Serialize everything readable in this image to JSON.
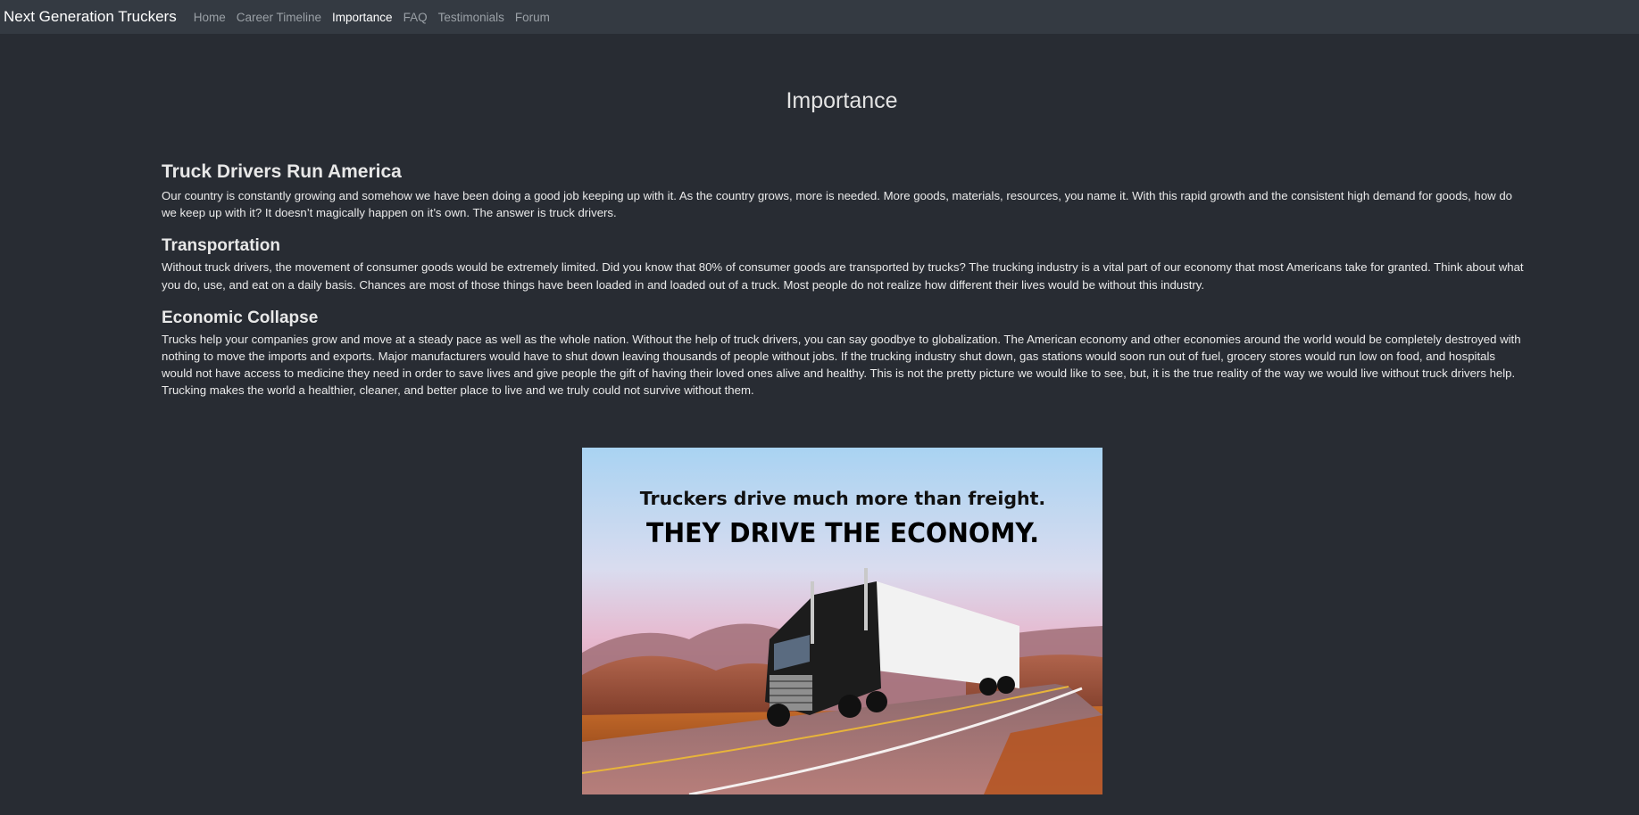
{
  "nav": {
    "brand": "Next Generation Truckers",
    "links": [
      "Home",
      "Career Timeline",
      "Importance",
      "FAQ",
      "Testimonials",
      "Forum"
    ],
    "active": "Importance"
  },
  "page": {
    "title": "Importance"
  },
  "sections": [
    {
      "heading": "Truck Drivers Run America",
      "text": "Our country is constantly growing and somehow we have been doing a good job keeping up with it. As the country grows, more is needed. More goods, materials, resources, you name it. With this rapid growth and the consistent high demand for goods, how do we keep up with it? It doesn’t magically happen on it’s own. The answer is truck drivers."
    },
    {
      "heading": "Transportation",
      "text": "Without truck drivers, the movement of consumer goods would be extremely limited. Did you know that 80% of consumer goods are transported by trucks? The trucking industry is a vital part of our economy that most Americans take for granted. Think about what you do, use, and eat on a daily basis. Chances are most of those things have been loaded in and loaded out of a truck. Most people do not realize how different their lives would be without this industry."
    },
    {
      "heading": "Economic Collapse",
      "text": "Trucks help your companies grow and move at a steady pace as well as the whole nation. Without the help of truck drivers, you can say goodbye to globalization. The American economy and other economies around the world would be completely destroyed with nothing to move the imports and exports. Major manufacturers would have to shut down leaving thousands of people without jobs. If the trucking industry shut down, gas stations would soon run out of fuel, grocery stores would run low on food, and hospitals would not have access to medicine they need in order to save lives and give people the gift of having their loved ones alive and healthy. This is not the pretty picture we would like to see, but, it is the true reality of the way we would live without truck drivers help. Trucking makes the world a healthier, cleaner, and better place to live and we truly could not survive without them."
    }
  ],
  "hero": {
    "line1": "Truckers drive much more than freight.",
    "line2": "THEY DRIVE THE ECONOMY."
  },
  "colors": {
    "background": "#282c33",
    "navbar": "#343a42"
  }
}
